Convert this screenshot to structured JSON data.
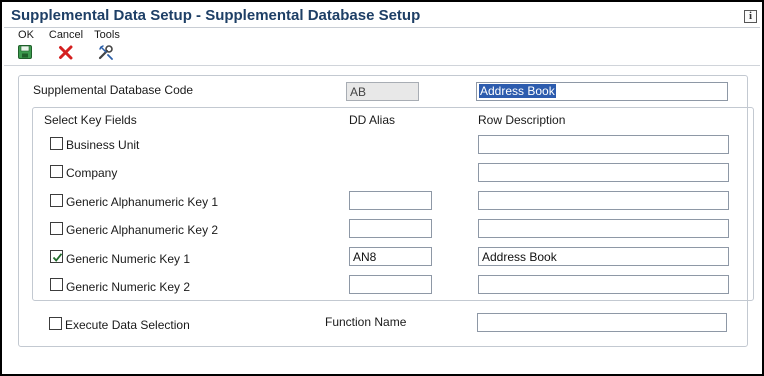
{
  "window": {
    "title": "Supplemental Data Setup - Supplemental Database Setup"
  },
  "toolbar": {
    "ok_label": "OK",
    "cancel_label": "Cancel",
    "tools_label": "Tools"
  },
  "form": {
    "db_code_label": "Supplemental Database Code",
    "db_code_value": "AB",
    "db_description_value": "Address Book",
    "key_fields_header": "Select Key Fields",
    "dd_alias_header": "DD Alias",
    "row_desc_header": "Row Description",
    "rows": [
      {
        "label": "Business Unit",
        "checked": false,
        "alias": "",
        "description": ""
      },
      {
        "label": "Company",
        "checked": false,
        "alias": "",
        "description": ""
      },
      {
        "label": "Generic Alphanumeric Key 1",
        "checked": false,
        "alias": "",
        "description": ""
      },
      {
        "label": "Generic Alphanumeric Key 2",
        "checked": false,
        "alias": "",
        "description": ""
      },
      {
        "label": "Generic Numeric Key 1",
        "checked": true,
        "alias": "AN8",
        "description": "Address Book"
      },
      {
        "label": "Generic Numeric Key 2",
        "checked": false,
        "alias": "",
        "description": ""
      }
    ],
    "execute_label": "Execute Data Selection",
    "execute_checked": false,
    "function_name_label": "Function Name",
    "function_name_value": ""
  },
  "colors": {
    "title": "#1e3f66",
    "selection": "#2d5cae",
    "ok_icon": "#2e8b3e",
    "cancel_icon": "#d42020"
  },
  "icons": {
    "info": "info-icon",
    "ok": "save-disk-icon",
    "cancel": "red-x-icon",
    "tools": "tools-icon",
    "checkmark": "checkmark-icon"
  }
}
